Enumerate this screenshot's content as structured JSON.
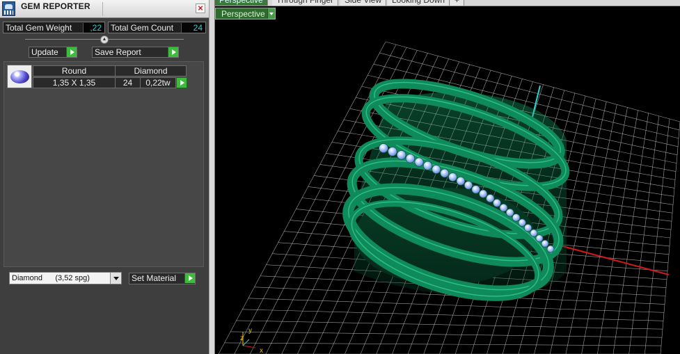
{
  "panel": {
    "title": "GEM REPORTER",
    "close_glyph": "×",
    "icons": {
      "app": "gem-reporter-app-icon",
      "close": "close-icon"
    }
  },
  "stats": {
    "total_gem_weight_label": "Total Gem Weight",
    "total_gem_weight_value": ",22",
    "total_gem_count_label": "Total Gem Count",
    "total_gem_count_value": "24"
  },
  "actions": {
    "update_label": "Update",
    "save_report_label": "Save Report"
  },
  "gem_list": [
    {
      "shape": "Round",
      "material": "Diamond",
      "size": "1,35 X 1,35",
      "count": "24",
      "weight": "0,22tw"
    }
  ],
  "material_picker": {
    "selected": "Diamond      (3,52 spg)",
    "set_material_label": "Set Material"
  },
  "viewport": {
    "tabs": [
      "Perspective",
      "Through Finger",
      "Side View",
      "Looking Down",
      "+"
    ],
    "active_tab": 0,
    "view_dropdown": "Perspective",
    "axes": {
      "x_label": "x",
      "y_label": "y",
      "z_label": "z"
    },
    "colors": {
      "grid": "#cfcfcf",
      "ring": "#0f8a5a",
      "gem": "#a9c8ff",
      "x_axis": "#d21a1a",
      "y_axis": "#2bd5d5",
      "z_axis": "#e0c020"
    }
  }
}
